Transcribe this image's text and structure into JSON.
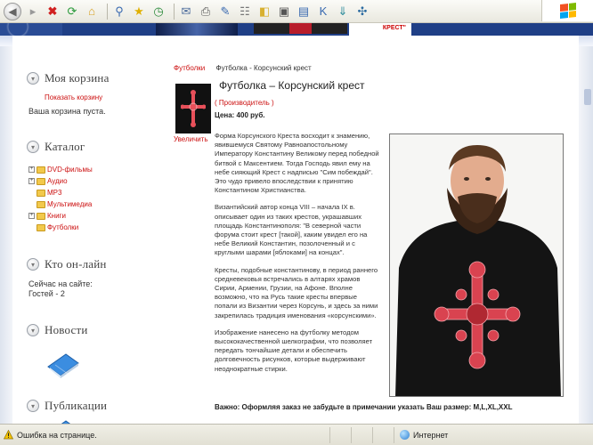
{
  "browser": {
    "toolbar_icons": [
      "back-icon",
      "forward-icon",
      "stop-icon",
      "refresh-icon",
      "home-icon",
      "search-icon",
      "favorites-icon",
      "history-icon",
      "mail-icon",
      "print-icon",
      "edit-icon",
      "discuss-icon",
      "messenger-icon",
      "research-icon",
      "folder-icon",
      "k-icon",
      "download-icon",
      "tools-icon"
    ],
    "status": {
      "message": "Ошибка на странице.",
      "zone": "Интернет"
    }
  },
  "banner": {
    "krest_text": "КРЕСТ\""
  },
  "sidebar": {
    "cart": {
      "title": "Моя корзина",
      "show_link": "Показать корзину",
      "empty_text": "Ваша корзина пуста."
    },
    "catalog": {
      "title": "Каталог",
      "items": [
        {
          "label": "DVD-фильмы",
          "expandable": true
        },
        {
          "label": "Аудио",
          "expandable": true
        },
        {
          "label": "MP3",
          "expandable": false
        },
        {
          "label": "Мультимедиа",
          "expandable": false
        },
        {
          "label": "Книги",
          "expandable": true
        },
        {
          "label": "Футболки",
          "expandable": false
        }
      ]
    },
    "online": {
      "title": "Кто он-лайн",
      "line1": "Сейчас на сайте:",
      "line2": "Гостей - 2"
    },
    "news": {
      "title": "Новости"
    },
    "publications": {
      "title": "Публикации"
    }
  },
  "content": {
    "breadcrumb": {
      "category": "Футболки",
      "current": "Футболка - Корсунский крест"
    },
    "product": {
      "title": "Футболка – Корсунский крест",
      "enlarge": "Увеличить",
      "maker": "( Производитель )",
      "price": "Цена: 400 руб.",
      "description": [
        "Форма Корсунского Креста восходит к знамению, явившемуся Святому Равноапостольному Императору Константину Великому перед победной битвой с Максентием. Тогда Господь явил ему на небе сияющий Крест с надписью \"Сим побеждай\". Это чудо привело впоследствии к принятию Константином Христианства.",
        "Византийский автор конца VIII – начала IX в. описывает один из таких крестов, украшавших площадь Константинополя: \"В северной части форума стоит крест [такой], каким увидел его на небе Великий Константин, позолоченный и с круглыми шарами [яблоками] на концах\".",
        "Кресты, подобные константинову, в период раннего средневековья встречались в алтарях храмов Сирии, Армении, Грузии, на Афоне. Вполне возможно, что на Русь такие кресты впервые попали из Византии через Корсунь, и здесь за ними закрепилась традиция именования «корсунскими».",
        "Изображение нанесено на футболку методом высококачественной шелкографии, что позволяет передать тончайшие детали и обеспечить долговечность рисунков, которые выдерживают неоднократные стирки."
      ],
      "size_note": "Важно: Оформляя заказ не забудьте в примечании указать Ваш размер: M,L,XL,XXL"
    }
  },
  "colors": {
    "accent_red": "#cc1010",
    "banner_blue": "#1f3f86"
  }
}
